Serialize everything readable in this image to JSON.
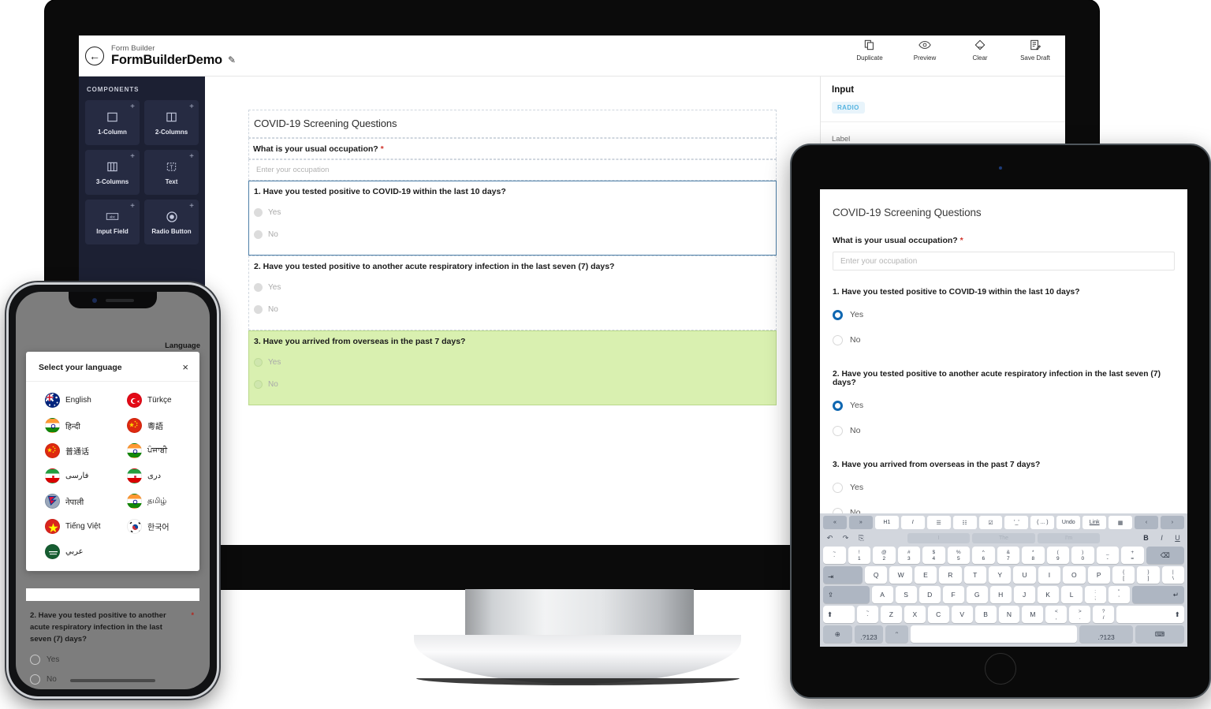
{
  "desktop": {
    "breadcrumb": "Form Builder",
    "app_title": "FormBuilderDemo",
    "edit_icon": "pencil-icon",
    "back_icon": "back-arrow-icon",
    "toolbar": [
      {
        "label": "Duplicate",
        "icon": "duplicate-icon"
      },
      {
        "label": "Preview",
        "icon": "eye-icon"
      },
      {
        "label": "Clear",
        "icon": "eraser-icon"
      },
      {
        "label": "Save Draft",
        "icon": "save-draft-icon"
      }
    ],
    "components": {
      "title": "COMPONENTS",
      "items": [
        {
          "label": "1-Column",
          "icon": "one-column-icon"
        },
        {
          "label": "2-Columns",
          "icon": "two-columns-icon"
        },
        {
          "label": "3-Columns",
          "icon": "three-columns-icon"
        },
        {
          "label": "Text",
          "icon": "text-icon"
        },
        {
          "label": "Input Field",
          "icon": "input-field-icon"
        },
        {
          "label": "Radio Button",
          "icon": "radio-button-icon"
        }
      ],
      "add_glyph": "+"
    },
    "form": {
      "heading": "COVID-19 Screening Questions",
      "occupation_label": "What is your usual occupation?",
      "required_mark": "*",
      "occupation_placeholder": "Enter your occupation",
      "questions": [
        {
          "title": "1. Have you tested positive to COVID-19 within the last 10 days?",
          "options": [
            "Yes",
            "No"
          ],
          "state": "selected"
        },
        {
          "title": "2. Have you tested positive to another acute respiratory infection in the last seven (7) days?",
          "options": [
            "Yes",
            "No"
          ],
          "state": "normal"
        },
        {
          "title": "3. Have you arrived from overseas in the past 7 days?",
          "options": [
            "Yes",
            "No"
          ],
          "state": "highlighted"
        }
      ]
    },
    "properties": {
      "title": "Input",
      "badge": "RADIO",
      "label_field": "Label"
    }
  },
  "phone": {
    "language_label": "Language",
    "dialog": {
      "title": "Select your language",
      "close_glyph": "×",
      "languages": [
        {
          "name": "English",
          "flag": "au-flag"
        },
        {
          "name": "Türkçe",
          "flag": "tr-flag"
        },
        {
          "name": "हिन्दी",
          "flag": "in-flag"
        },
        {
          "name": "粵語",
          "flag": "cn-flag"
        },
        {
          "name": "普通话",
          "flag": "cn-flag"
        },
        {
          "name": "ਪੰਜਾਬੀ",
          "flag": "in-flag"
        },
        {
          "name": "فارسی",
          "flag": "ir-flag"
        },
        {
          "name": "دری",
          "flag": "af-flag"
        },
        {
          "name": "नेपाली",
          "flag": "np-flag"
        },
        {
          "name": "தமிழ்",
          "flag": "in-flag"
        },
        {
          "name": "Tiếng Việt",
          "flag": "vn-flag"
        },
        {
          "name": "한국어",
          "flag": "kr-flag"
        },
        {
          "name": "عربي",
          "flag": "sa-flag"
        }
      ]
    },
    "form_question": {
      "title": "2. Have you tested positive to another acute respiratory infection in the last seven (7) days?",
      "required_mark": "*",
      "options": [
        "Yes",
        "No"
      ]
    }
  },
  "tablet": {
    "form": {
      "heading": "COVID-19 Screening Questions",
      "occupation_label": "What is your usual occupation?",
      "required_mark": "*",
      "occupation_placeholder": "Enter your occupation",
      "questions": [
        {
          "title": "1. Have you tested positive to COVID-19 within the last 10 days?",
          "options": [
            "Yes",
            "No"
          ],
          "selected": "Yes"
        },
        {
          "title": "2. Have you tested positive to another acute respiratory infection in the last seven (7) days?",
          "options": [
            "Yes",
            "No"
          ],
          "selected": "Yes"
        },
        {
          "title": "3. Have you arrived from overseas in the past 7 days?",
          "options": [
            "Yes",
            "No"
          ],
          "selected": null
        }
      ]
    },
    "keyboard": {
      "toolbar": [
        "«",
        "»",
        "H1",
        "I",
        "☰",
        "☷",
        "☑",
        "'_'",
        "( ... )",
        "Undo",
        "Link",
        "▦",
        "‹",
        "›"
      ],
      "suggestions": [
        "I",
        "The",
        "I'm"
      ],
      "format_keys": [
        "B",
        "I",
        "U"
      ],
      "history_keys": [
        "↶",
        "↷",
        "⎘"
      ],
      "number_row": [
        {
          "up": "~",
          "dn": "`"
        },
        {
          "up": "!",
          "dn": "1"
        },
        {
          "up": "@",
          "dn": "2"
        },
        {
          "up": "#",
          "dn": "3"
        },
        {
          "up": "$",
          "dn": "4"
        },
        {
          "up": "%",
          "dn": "5"
        },
        {
          "up": "^",
          "dn": "6"
        },
        {
          "up": "&",
          "dn": "7"
        },
        {
          "up": "*",
          "dn": "8"
        },
        {
          "up": "(",
          "dn": "9"
        },
        {
          "up": ")",
          "dn": "0"
        },
        {
          "up": "_",
          "dn": "-"
        },
        {
          "up": "+",
          "dn": "="
        }
      ],
      "backspace": "⌫",
      "tab": "⇥",
      "row_q": [
        "Q",
        "W",
        "E",
        "R",
        "T",
        "Y",
        "U",
        "I",
        "O",
        "P"
      ],
      "row_q_extra": [
        {
          "up": "{",
          "dn": "["
        },
        {
          "up": "}",
          "dn": "]"
        },
        {
          "up": "|",
          "dn": "\\"
        }
      ],
      "caps": "⇪",
      "row_a": [
        "A",
        "S",
        "D",
        "F",
        "G",
        "H",
        "J",
        "K",
        "L"
      ],
      "row_a_extra": [
        {
          "up": ":",
          "dn": ";"
        },
        {
          "up": "\"",
          "dn": "'"
        }
      ],
      "enter": "↵",
      "shift_left": "⬆",
      "row_z": [
        "Z",
        "X",
        "C",
        "V",
        "B",
        "N",
        "M"
      ],
      "row_z_tilde": {
        "up": "~",
        "dn": "`"
      },
      "row_z_extra": [
        {
          "up": "<",
          "dn": ","
        },
        {
          "up": ">",
          "dn": "."
        },
        {
          "up": "?",
          "dn": "/"
        }
      ],
      "shift_right": "⬆",
      "globe": "⊕",
      "num_left": ".?123",
      "mic": "ᵔ",
      "space": "",
      "num_right": ".?123",
      "dismiss": "⌨"
    }
  }
}
